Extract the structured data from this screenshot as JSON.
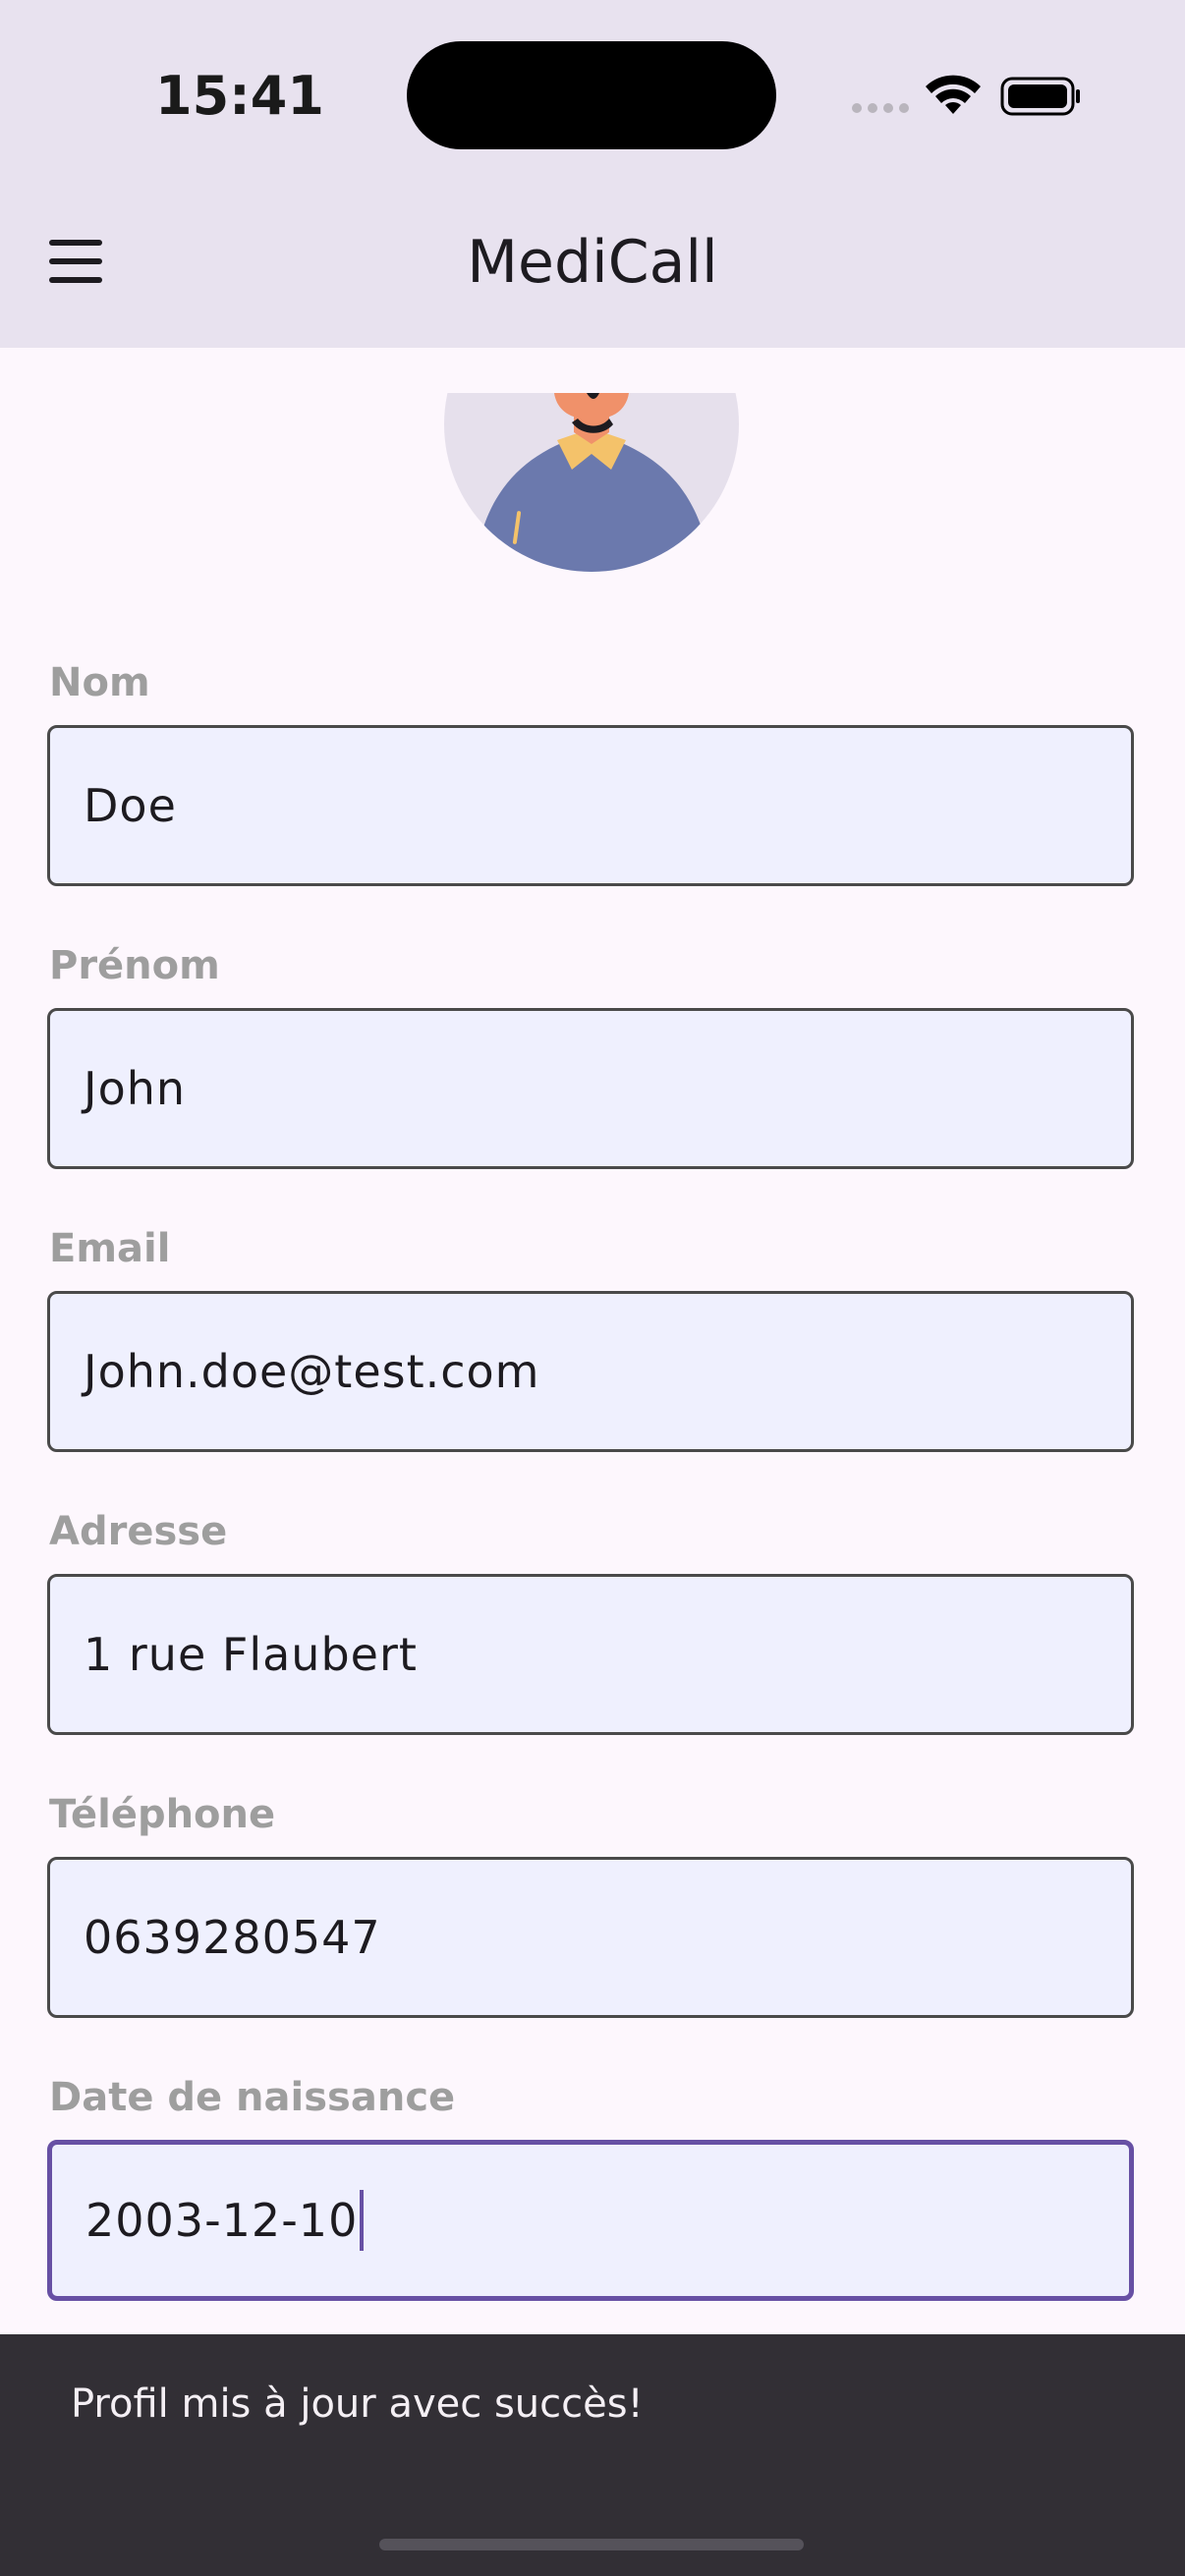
{
  "status_bar": {
    "time": "15:41",
    "icons": [
      "signal-dots-icon",
      "wifi-icon",
      "battery-icon"
    ]
  },
  "app_bar": {
    "title": "MediCall",
    "menu_icon": "menu-icon"
  },
  "profile": {
    "avatar": "avatar-illustration"
  },
  "form": {
    "fields": [
      {
        "label": "Nom",
        "value": "Doe"
      },
      {
        "label": "Prénom",
        "value": "John"
      },
      {
        "label": "Email",
        "value": "John.doe@test.com"
      },
      {
        "label": "Adresse",
        "value": "1 rue Flaubert"
      },
      {
        "label": "Téléphone",
        "value": "0639280547"
      },
      {
        "label": "Date de naissance",
        "value": "2003-12-10"
      }
    ]
  },
  "snackbar": {
    "message": "Profil mis à jour avec succès!"
  },
  "colors": {
    "app_bar_bg": "#e8e2ef",
    "page_bg": "#fdf7fd",
    "field_bg": "#eff0fe",
    "focus_accent": "#6750a4",
    "snackbar_bg": "#322f35"
  }
}
